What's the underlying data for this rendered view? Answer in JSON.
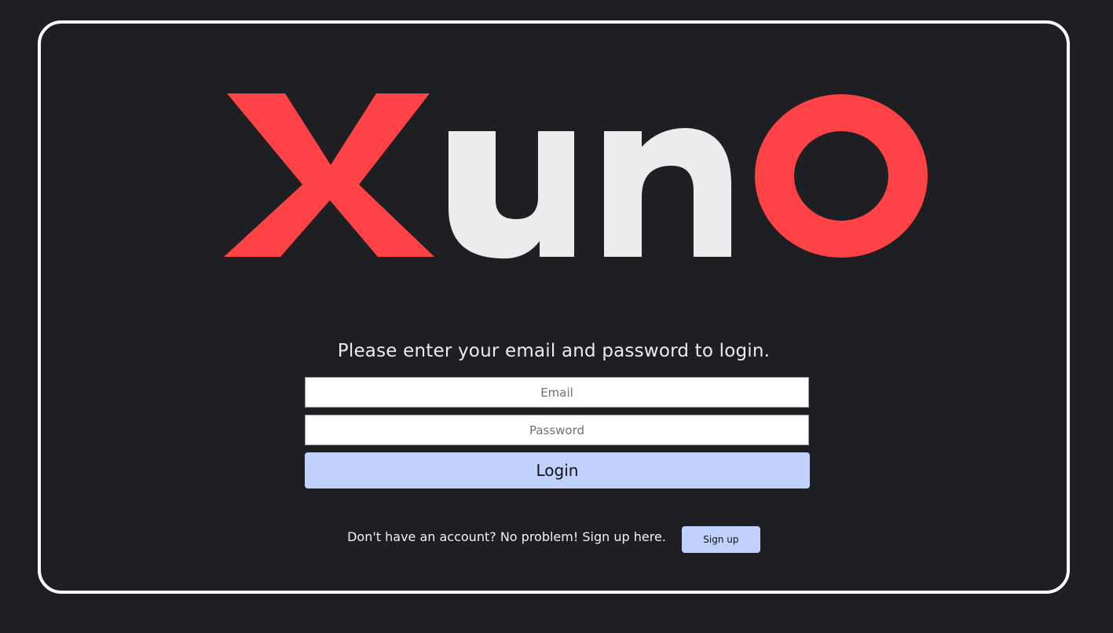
{
  "brand": {
    "logo_letters": [
      "X",
      "u",
      "n",
      "O"
    ],
    "colors": {
      "accent_red": "#ff4246",
      "logo_white": "#ececec",
      "background": "#1e1f23",
      "button_blue": "#c0d1fd"
    }
  },
  "login": {
    "prompt": "Please enter your email and password to login.",
    "email_placeholder": "Email",
    "password_placeholder": "Password",
    "login_label": "Login"
  },
  "signup": {
    "text": "Don't have an account? No problem! Sign up here.",
    "button_label": "Sign up"
  }
}
